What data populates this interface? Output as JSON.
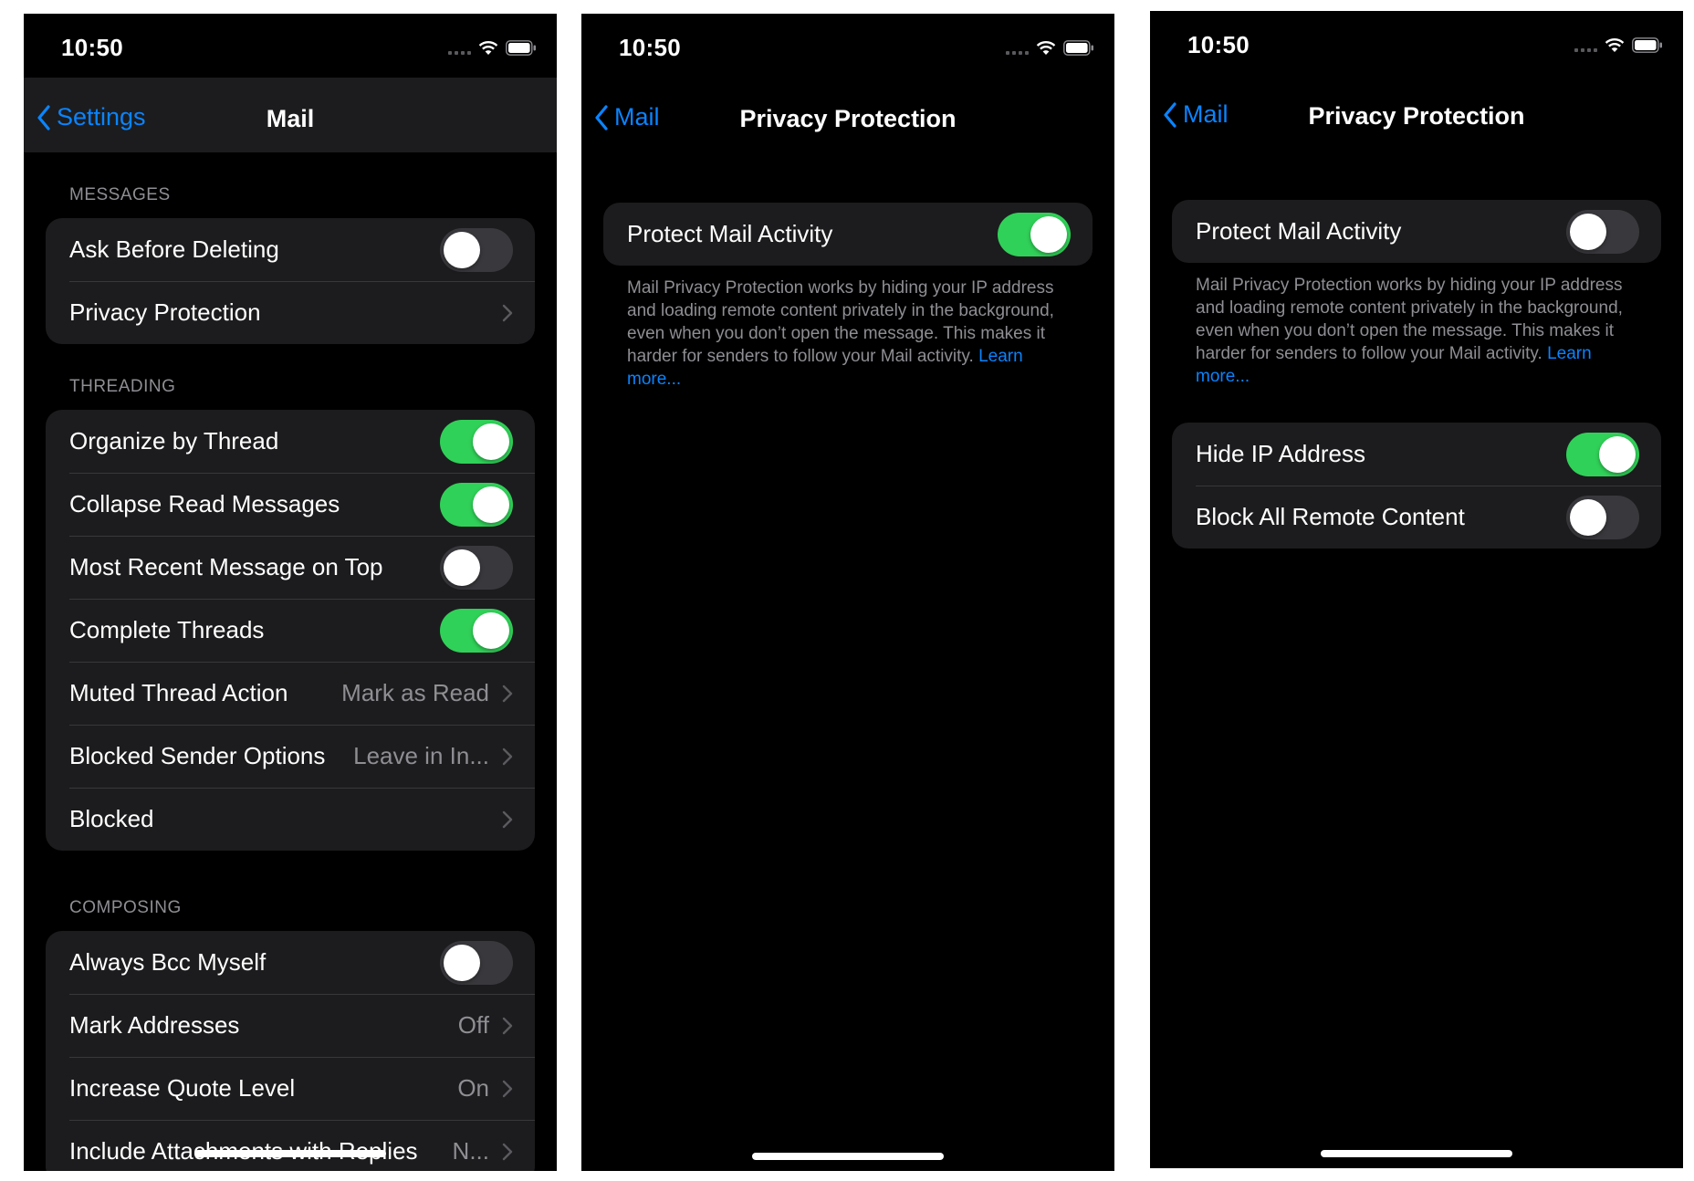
{
  "screens": [
    {
      "time": "10:50",
      "back_label": "Settings",
      "title": "Mail",
      "sections": [
        {
          "header": "MESSAGES",
          "rows": [
            {
              "label": "Ask Before Deleting",
              "toggle": "off"
            },
            {
              "label": "Privacy Protection",
              "chevron": true
            }
          ]
        },
        {
          "header": "THREADING",
          "rows": [
            {
              "label": "Organize by Thread",
              "toggle": "on"
            },
            {
              "label": "Collapse Read Messages",
              "toggle": "on"
            },
            {
              "label": "Most Recent Message on Top",
              "toggle": "off"
            },
            {
              "label": "Complete Threads",
              "toggle": "on"
            },
            {
              "label": "Muted Thread Action",
              "value": "Mark as Read",
              "chevron": true
            },
            {
              "label": "Blocked Sender Options",
              "value": "Leave in In...",
              "chevron": true
            },
            {
              "label": "Blocked",
              "chevron": true
            }
          ]
        },
        {
          "header": "COMPOSING",
          "rows": [
            {
              "label": "Always Bcc Myself",
              "toggle": "off"
            },
            {
              "label": "Mark Addresses",
              "value": "Off",
              "chevron": true
            },
            {
              "label": "Increase Quote Level",
              "value": "On",
              "chevron": true
            },
            {
              "label": "Include Attachments with Replies",
              "value": "N...",
              "chevron": true
            }
          ]
        }
      ]
    },
    {
      "time": "10:50",
      "back_label": "Mail",
      "title": "Privacy Protection",
      "sections": [
        {
          "rows": [
            {
              "label": "Protect Mail Activity",
              "toggle": "on"
            }
          ],
          "footer": {
            "text": "Mail Privacy Protection works by hiding your IP address and loading remote content privately in the background, even when you don’t open the message. This makes it harder for senders to follow your Mail activity.",
            "link": "Learn more..."
          }
        }
      ]
    },
    {
      "time": "10:50",
      "back_label": "Mail",
      "title": "Privacy Protection",
      "sections": [
        {
          "rows": [
            {
              "label": "Protect Mail Activity",
              "toggle": "off"
            }
          ],
          "footer": {
            "text": "Mail Privacy Protection works by hiding your IP address and loading remote content privately in the background, even when you don’t open the message. This makes it harder for senders to follow your Mail activity.",
            "link": "Learn more..."
          }
        },
        {
          "rows": [
            {
              "label": "Hide IP Address",
              "toggle": "on"
            },
            {
              "label": "Block All Remote Content",
              "toggle": "off"
            }
          ]
        }
      ]
    }
  ],
  "colors": {
    "accent": "#0a84ff",
    "toggle_on": "#30d158",
    "toggle_off": "#39393d",
    "cell_background": "#1c1c1e",
    "secondary_text": "#8e8e93"
  },
  "icons": [
    "back-chevron-icon",
    "chevron-right-icon",
    "signal-icon",
    "wifi-icon",
    "battery-icon"
  ]
}
